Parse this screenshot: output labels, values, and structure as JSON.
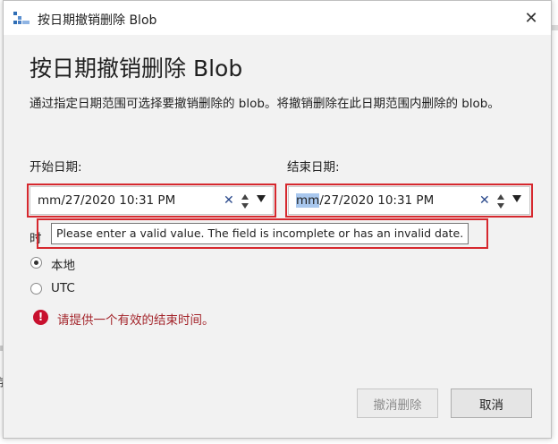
{
  "window": {
    "title": "按日期撤销删除 Blob",
    "close_glyph": "✕"
  },
  "dialog": {
    "heading": "按日期撤销删除 Blob",
    "description": "通过指定日期范围可选择要撤销删除的 blob。将撤销删除在此日期范围内删除的 blob。"
  },
  "start_date": {
    "label": "开始日期:",
    "value_mm": "mm",
    "value_rest": "/27/2020  10:31  PM"
  },
  "end_date": {
    "label": "结束日期:",
    "value_mm": "mm",
    "value_rest": "/27/2020  10:31  PM"
  },
  "timezone": {
    "label_partial": "时",
    "options": [
      {
        "label": "本地",
        "checked": true
      },
      {
        "label": "UTC",
        "checked": false
      }
    ]
  },
  "tooltip": {
    "text": "Please enter a valid value. The field is incomplete or has an invalid date."
  },
  "error": {
    "text": "请提供一个有效的结束时间。",
    "color": "#a4262c"
  },
  "buttons": {
    "undelete": "撤消删除",
    "cancel": "取消"
  },
  "background": {
    "left_char": "存"
  },
  "colors": {
    "highlight_frame": "#d6282e",
    "selection": "#a8c7ee"
  }
}
